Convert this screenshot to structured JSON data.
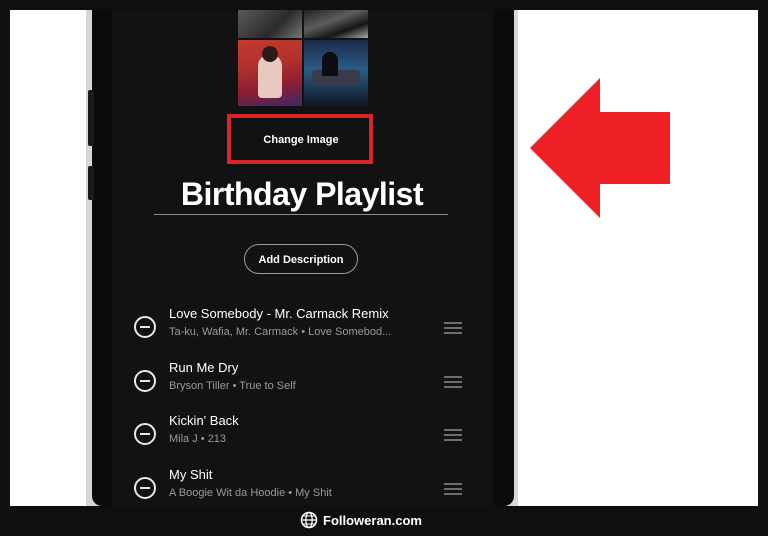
{
  "playlist": {
    "change_image_label": "Change Image",
    "title": "Birthday Playlist",
    "add_description_label": "Add Description"
  },
  "tracks": [
    {
      "name": "Love Somebody - Mr. Carmack Remix",
      "subtitle": "Ta-ku, Wafia, Mr. Carmack • Love Somebod..."
    },
    {
      "name": "Run Me Dry",
      "subtitle": "Bryson Tiller • True to Self"
    },
    {
      "name": "Kickin' Back",
      "subtitle": "Mila J • 213"
    },
    {
      "name": "My Shit",
      "subtitle": "A Boogie Wit da Hoodie • My Shit"
    }
  ],
  "watermark": {
    "text": "Followeran.com"
  },
  "colors": {
    "highlight_red": "#d8262a",
    "arrow_red": "#ee2226"
  },
  "icons": {
    "remove": "minus-circle-icon",
    "reorder": "drag-handle-icon",
    "brand": "globe-icon"
  }
}
